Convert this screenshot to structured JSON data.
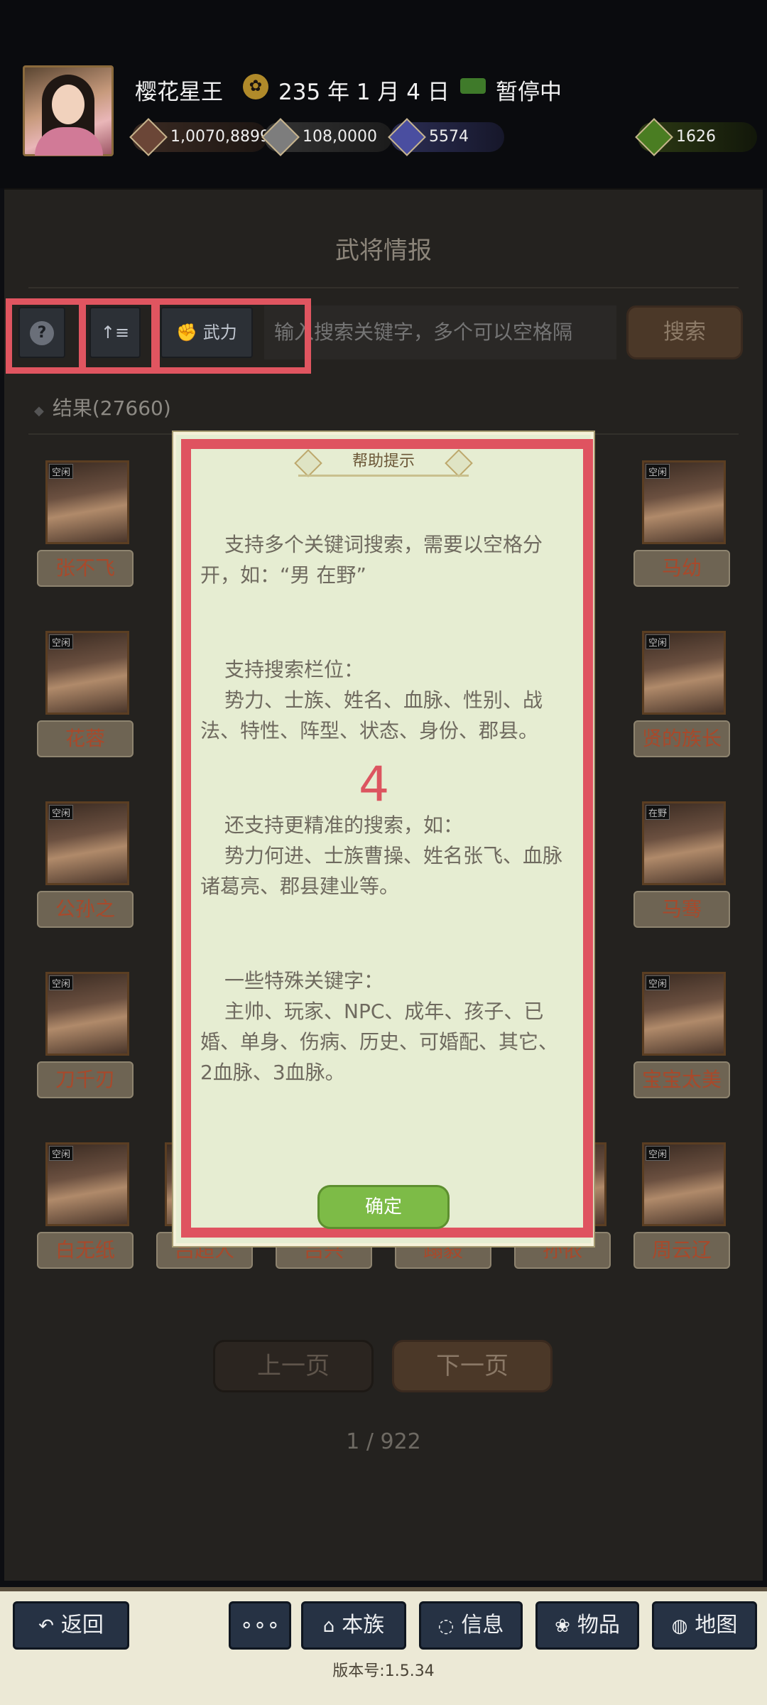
{
  "header": {
    "player_name": "樱花星王",
    "date": "235 年 1 月 4 日",
    "status": "暂停中",
    "resources": {
      "gold": "1,0070,8899",
      "silver": "108,0000",
      "army": "5574",
      "food": "1626"
    }
  },
  "panel": {
    "title": "武将情报",
    "force_button": "武力",
    "search_placeholder": "输入搜索关键字，多个可以空格隔",
    "search_button": "搜索",
    "results": "结果(27660)"
  },
  "cards": [
    {
      "name": "张不飞",
      "tag": "空闲"
    },
    {
      "name": "马幼",
      "tag": "空闲"
    },
    {
      "name": "花蓉",
      "tag": "空闲"
    },
    {
      "name": "贤的族长",
      "tag": "空闲"
    },
    {
      "name": "公孙之",
      "tag": "空闲"
    },
    {
      "name": "马骞",
      "tag": "在野"
    },
    {
      "name": "刀千刃",
      "tag": "空闲"
    },
    {
      "name": "宝宝太美",
      "tag": "空闲"
    },
    {
      "name": "白无纸",
      "tag": "空闲"
    },
    {
      "name": "吕超人",
      "tag": ""
    },
    {
      "name": "吕兴",
      "tag": ""
    },
    {
      "name": "蹋毅",
      "tag": ""
    },
    {
      "name": "孙依",
      "tag": ""
    },
    {
      "name": "周云辽",
      "tag": "空闲"
    }
  ],
  "pagination": {
    "prev": "上一页",
    "next": "下一页",
    "page": "1 / 922"
  },
  "dialog": {
    "title": "帮助提示",
    "p1": "支持多个关键词搜索，需要以空格分开，如：“男 在野”",
    "p2_head": "支持搜索栏位：",
    "p2": "势力、士族、姓名、血脉、性别、战法、特性、阵型、状态、身份、郡县。",
    "marker": "4",
    "p3_head": "还支持更精准的搜索，如：",
    "p3": "势力何进、士族曹操、姓名张飞、血脉诸葛亮、郡县建业等。",
    "p4_head": "一些特殊关键字：",
    "p4": "主帅、玩家、NPC、成年、孩子、已婚、单身、伤病、历史、可婚配、其它、2血脉、3血脉。",
    "ok": "确定"
  },
  "nav": {
    "back": "返回",
    "more": "∘∘∘",
    "clan": "本族",
    "info": "信息",
    "items": "物品",
    "map": "地图"
  },
  "version": "版本号:1.5.34"
}
